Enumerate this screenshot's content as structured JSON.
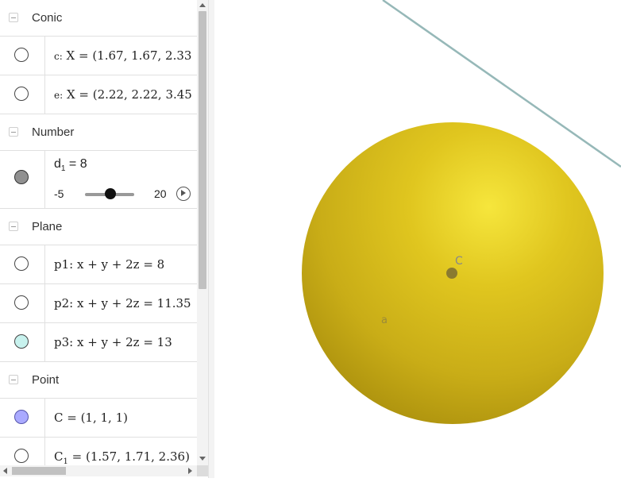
{
  "algebra_view": {
    "groups": [
      {
        "label": "Conic",
        "items": [
          {
            "name_prefix": "c:",
            "expr": "X = (1.67, 1.67, 2.33"
          },
          {
            "name_prefix": "e:",
            "expr": "X = (2.22, 2.22, 3.45"
          }
        ]
      },
      {
        "label": "Number",
        "slider": {
          "name": "d",
          "subscript": "1",
          "equals": "= 8",
          "value": 8,
          "min": "-5",
          "max": "20",
          "min_value": -5,
          "max_value": 20
        }
      },
      {
        "label": "Plane",
        "items": [
          {
            "expr": "p1: x + y + 2z = 8"
          },
          {
            "expr": "p2: x + y + 2z = 11.35"
          },
          {
            "expr": "p3: x + y + 2z = 13"
          }
        ]
      },
      {
        "label": "Point",
        "items": [
          {
            "expr": "C = (1, 1, 1)"
          },
          {
            "name_main": "C",
            "subscript": "1",
            "expr": " = (1.57, 1.71, 2.36)"
          }
        ]
      }
    ]
  },
  "graphics": {
    "point_label": "C",
    "sphere_label": "a"
  },
  "colors": {
    "sphere": "#d8bd1b",
    "sphere_highlight": "#f2e23a",
    "line": "#96b8b8",
    "p3_fill": "#c8f2ee",
    "point_fill": "#aaaaff",
    "slider_dot": "#909090"
  }
}
